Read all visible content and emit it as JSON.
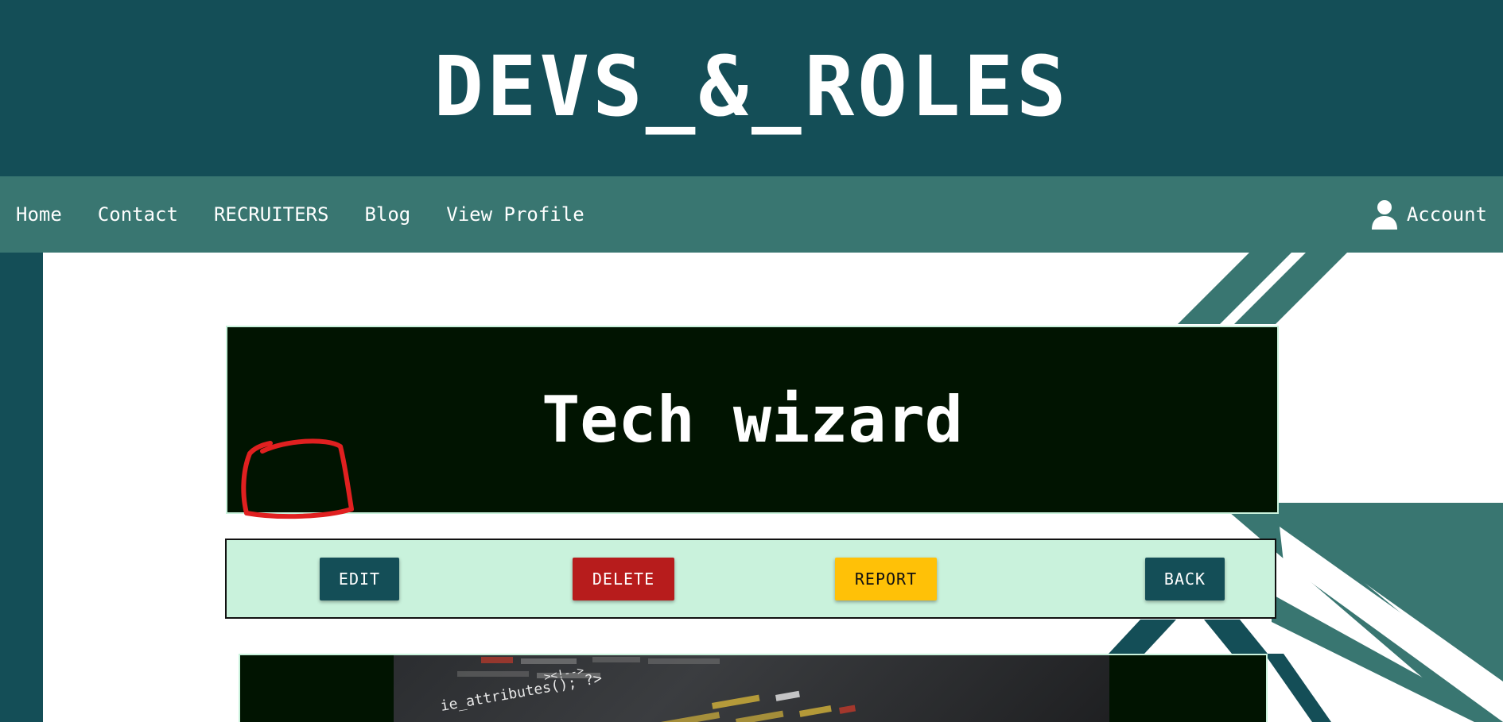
{
  "header": {
    "title": "DEVS_&_ROLES"
  },
  "nav": {
    "links": [
      "Home",
      "Contact",
      "RECRUITERS",
      "Blog",
      "View Profile"
    ],
    "account_label": "Account",
    "account_icon": "user-icon"
  },
  "hero": {
    "title": "Tech wizard"
  },
  "actions": {
    "edit_label": "EDIT",
    "delete_label": "DELETE",
    "report_label": "REPORT",
    "back_label": "BACK"
  },
  "image": {
    "visible_code": "ie_attributes(); ?>"
  },
  "colors": {
    "header_bg": "#144e57",
    "nav_bg": "#397671",
    "hero_bg": "#011401",
    "action_bar_bg": "#c9f2dc",
    "edit_back_btn": "#144e57",
    "delete_btn": "#b71c1c",
    "report_btn": "#ffc107",
    "annotation": "#e02020"
  }
}
